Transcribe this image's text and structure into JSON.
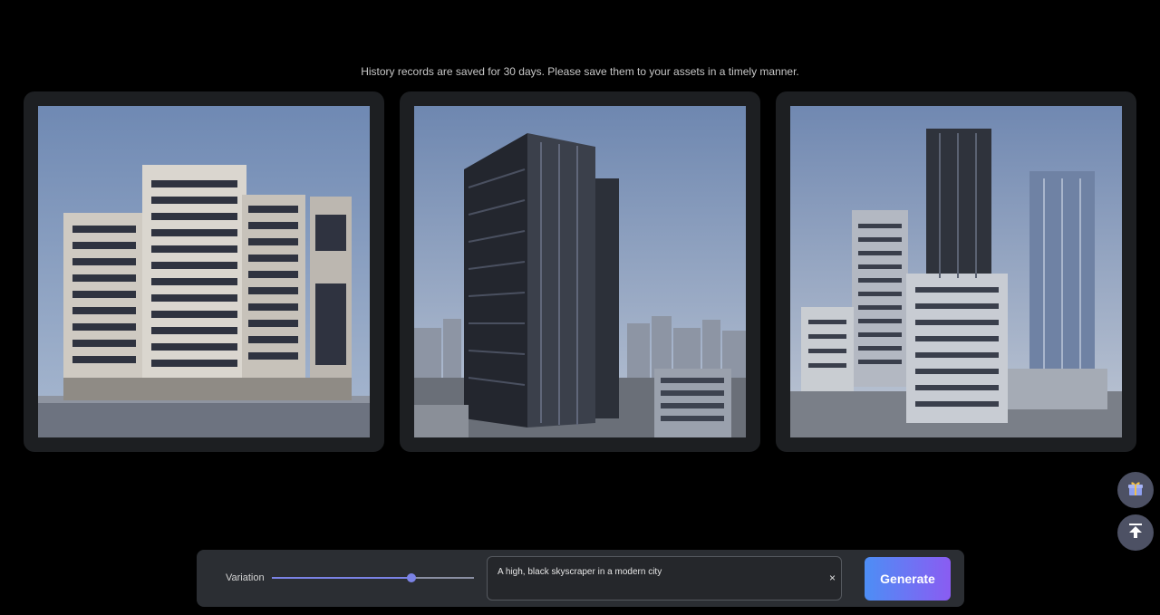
{
  "notice": "History records are saved for 30 days. Please save them to your assets in a timely manner.",
  "gallery": {
    "images": [
      {
        "subject": "mid-rise modern office building"
      },
      {
        "subject": "black skyscraper in a modern city"
      },
      {
        "subject": "cluster of modern towers"
      }
    ]
  },
  "side_buttons": {
    "gift_icon": "gift-icon",
    "top_icon": "arrow-up-to-top-icon"
  },
  "controls": {
    "variation_label": "Variation",
    "variation_value": 0.69,
    "prompt_text": "A high, black skyscraper in a modern city",
    "clear_symbol": "×",
    "generate_label": "Generate"
  },
  "colors": {
    "background": "#000000",
    "card": "#1d1f22",
    "accent": "#7b83e6",
    "generate_from": "#4d8ef5",
    "generate_to": "#8a5cf2"
  }
}
